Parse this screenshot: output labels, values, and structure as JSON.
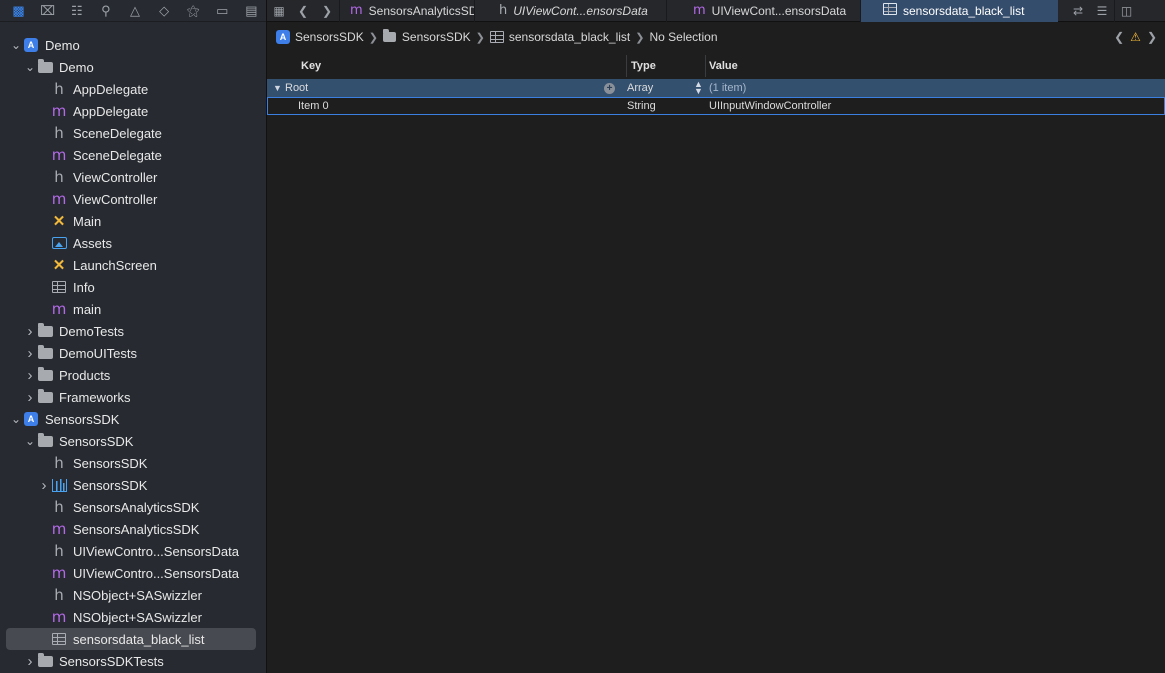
{
  "sidebar": {
    "toolbar_icons": [
      "folder-icon",
      "source-control-icon",
      "hierarchy-icon",
      "search-icon",
      "warning-icon",
      "test-icon",
      "debug-icon",
      "breakpoint-icon",
      "report-icon"
    ],
    "tree": [
      {
        "label": "Demo",
        "icon": "project",
        "indent": 0,
        "expanded": true
      },
      {
        "label": "Demo",
        "icon": "folder",
        "indent": 1,
        "expanded": true
      },
      {
        "label": "AppDelegate",
        "icon": "h",
        "indent": 2
      },
      {
        "label": "AppDelegate",
        "icon": "m",
        "indent": 2
      },
      {
        "label": "SceneDelegate",
        "icon": "h",
        "indent": 2
      },
      {
        "label": "SceneDelegate",
        "icon": "m",
        "indent": 2
      },
      {
        "label": "ViewController",
        "icon": "h",
        "indent": 2
      },
      {
        "label": "ViewController",
        "icon": "m",
        "indent": 2
      },
      {
        "label": "Main",
        "icon": "storyboard",
        "indent": 2
      },
      {
        "label": "Assets",
        "icon": "assets",
        "indent": 2
      },
      {
        "label": "LaunchScreen",
        "icon": "storyboard",
        "indent": 2
      },
      {
        "label": "Info",
        "icon": "plist",
        "indent": 2
      },
      {
        "label": "main",
        "icon": "m",
        "indent": 2
      },
      {
        "label": "DemoTests",
        "icon": "folder",
        "indent": 1,
        "expanded": false
      },
      {
        "label": "DemoUITests",
        "icon": "folder",
        "indent": 1,
        "expanded": false
      },
      {
        "label": "Products",
        "icon": "folder",
        "indent": 1,
        "expanded": false
      },
      {
        "label": "Frameworks",
        "icon": "folder",
        "indent": 1,
        "expanded": false
      },
      {
        "label": "SensorsSDK",
        "icon": "project",
        "indent": 0,
        "expanded": true
      },
      {
        "label": "SensorsSDK",
        "icon": "folder",
        "indent": 1,
        "expanded": true
      },
      {
        "label": "SensorsSDK",
        "icon": "h",
        "indent": 2
      },
      {
        "label": "SensorsSDK",
        "icon": "framework",
        "indent": 2,
        "expanded": false
      },
      {
        "label": "SensorsAnalyticsSDK",
        "icon": "h",
        "indent": 2
      },
      {
        "label": "SensorsAnalyticsSDK",
        "icon": "m",
        "indent": 2
      },
      {
        "label": "UIViewContro...SensorsData",
        "icon": "h",
        "indent": 2
      },
      {
        "label": "UIViewContro...SensorsData",
        "icon": "m",
        "indent": 2
      },
      {
        "label": "NSObject+SASwizzler",
        "icon": "h",
        "indent": 2
      },
      {
        "label": "NSObject+SASwizzler",
        "icon": "m",
        "indent": 2
      },
      {
        "label": "sensorsdata_black_list",
        "icon": "plist",
        "indent": 2,
        "selected": true
      },
      {
        "label": "SensorsSDKTests",
        "icon": "folder",
        "indent": 1,
        "expanded": false
      }
    ]
  },
  "tabs": [
    {
      "label": "SensorsAnalyticsSDK",
      "icon": "m",
      "italic": false
    },
    {
      "label": "UIViewCont...ensorsData",
      "icon": "h",
      "italic": true
    },
    {
      "label": "UIViewCont...ensorsData",
      "icon": "m",
      "italic": false
    },
    {
      "label": "sensorsdata_black_list",
      "icon": "plist",
      "italic": false,
      "active": true
    }
  ],
  "jumpbar": {
    "crumbs": [
      "SensorsSDK",
      "SensorsSDK",
      "sensorsdata_black_list",
      "No Selection"
    ]
  },
  "plist": {
    "headers": {
      "key": "Key",
      "type": "Type",
      "value": "Value"
    },
    "root": {
      "key": "Root",
      "type": "Array",
      "value": "(1 item)"
    },
    "items": [
      {
        "key": "Item 0",
        "type": "String",
        "value": "UIInputWindowController"
      }
    ]
  },
  "colors": {
    "accent": "#3b8dfd",
    "selection": "#34506f",
    "m_icon": "#b469e8",
    "storyboard": "#f2b93b"
  }
}
